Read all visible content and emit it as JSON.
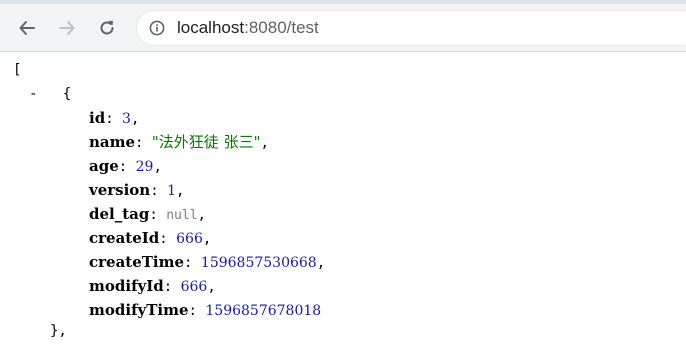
{
  "browser": {
    "url_host": "localhost",
    "url_rest": ":8080/test",
    "icons": [
      "back-icon",
      "forward-icon",
      "reload-icon",
      "info-icon"
    ]
  },
  "json_view": {
    "open_bracket": "[",
    "collapse_toggle": "-",
    "open_brace": "{",
    "close_brace": "},",
    "fields": [
      {
        "key": "id",
        "value": "3",
        "type": "number"
      },
      {
        "key": "name",
        "value": "\"法外狂徒 张三\"",
        "type": "string"
      },
      {
        "key": "age",
        "value": "29",
        "type": "number"
      },
      {
        "key": "version",
        "value": "1",
        "type": "number"
      },
      {
        "key": "del_tag",
        "value": "null",
        "type": "null"
      },
      {
        "key": "createId",
        "value": "666",
        "type": "number"
      },
      {
        "key": "createTime",
        "value": "1596857530668",
        "type": "number"
      },
      {
        "key": "modifyId",
        "value": "666",
        "type": "number"
      },
      {
        "key": "modifyTime",
        "value": "1596857678018",
        "type": "number"
      }
    ]
  }
}
